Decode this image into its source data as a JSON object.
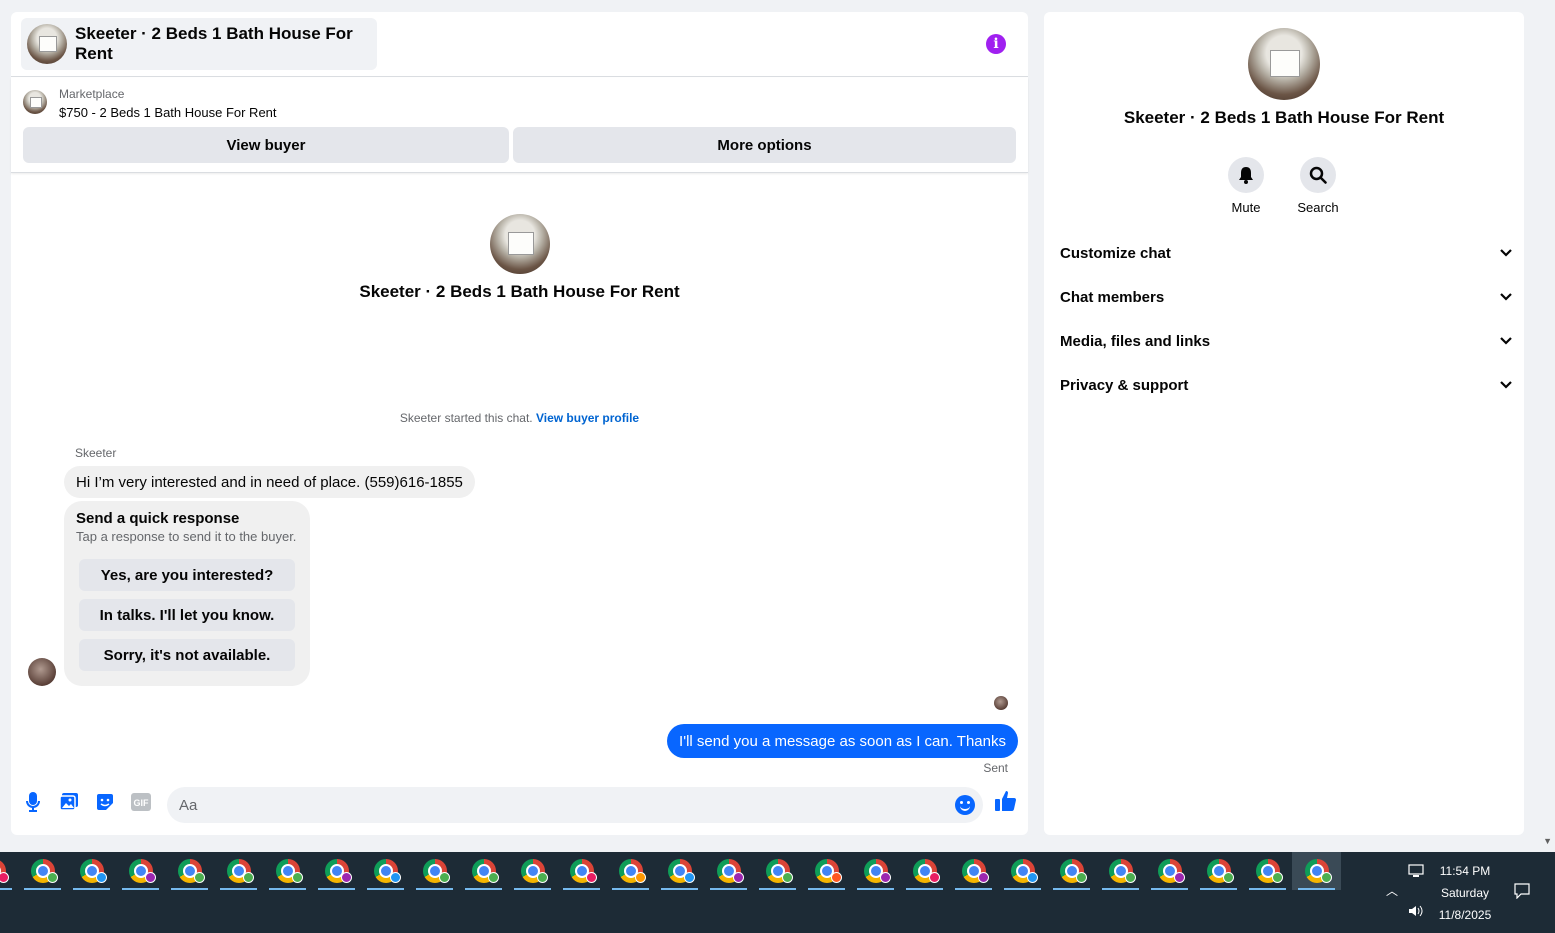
{
  "chat": {
    "title": "Skeeter · 2 Beds 1 Bath House For Rent",
    "listing_label": "Marketplace",
    "listing_price": "$750 - 2 Beds 1 Bath House For Rent",
    "view_buyer": "View buyer",
    "more_options": "More options",
    "intro_title": "Skeeter · 2 Beds 1 Bath House For Rent",
    "started_text": "Skeeter started this chat. ",
    "view_buyer_profile": "View buyer profile",
    "sender_name": "Skeeter",
    "incoming_message": "Hi I’m very interested and in need of place. (559)616-1855",
    "quick_title": "Send a quick response",
    "quick_sub": "Tap a response to send it to the buyer.",
    "quick_responses": [
      "Yes, are you interested?",
      "In talks. I'll let you know.",
      "Sorry, it's not available."
    ],
    "outgoing_message": "I'll send you a message as soon as I can. Thanks",
    "sent_label": "Sent",
    "composer_placeholder": "Aa"
  },
  "info": {
    "title": "Skeeter · 2 Beds 1 Bath House For Rent",
    "actions": [
      {
        "label": "Mute",
        "icon": "bell-icon"
      },
      {
        "label": "Search",
        "icon": "search-icon"
      }
    ],
    "sections": [
      "Customize chat",
      "Chat members",
      "Media, files and links",
      "Privacy & support"
    ]
  },
  "taskbar": {
    "time": "11:54 PM",
    "day": "Saturday",
    "date": "11/8/2025",
    "app_badges": [
      "#e91e63",
      "#4caf50",
      "#2196f3",
      "#9c27b0",
      "#4caf50",
      "#4caf50",
      "#4caf50",
      "#9c27b0",
      "#2196f3",
      "#4caf50",
      "#4caf50",
      "#4caf50",
      "#e91e63",
      "#ff9800",
      "#2196f3",
      "#9c27b0",
      "#4caf50",
      "#ff5722",
      "#9c27b0",
      "#e91e63",
      "#9c27b0",
      "#2196f3",
      "#4caf50",
      "#4caf50",
      "#9c27b0",
      "#4caf50",
      "#4caf50",
      "#4caf50"
    ]
  },
  "colors": {
    "accent": "#0866ff",
    "info_purple": "#a020f0"
  }
}
